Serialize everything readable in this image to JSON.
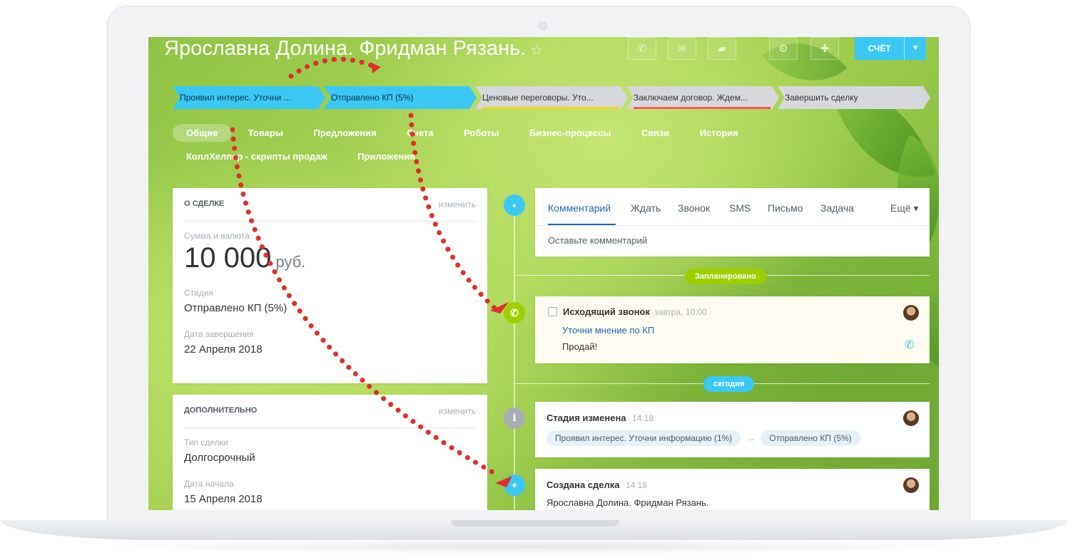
{
  "deal": {
    "title": "Ярославна Долина. Фридман Рязань.",
    "invoice_label": "СЧЁТ"
  },
  "stages": [
    {
      "label": "Проявил интерес. Уточни ...",
      "state": "done",
      "color": "#3bc8f5"
    },
    {
      "label": "Отправлено КП (5%)",
      "state": "done",
      "color": "#3bc8f5"
    },
    {
      "label": "Ценовые переговоры. Уто...",
      "state": "todo",
      "color": "#f7d622"
    },
    {
      "label": "Заключаем договор. Ждем...",
      "state": "todo",
      "color": "#ff5752"
    },
    {
      "label": "Завершить сделку",
      "state": "todo",
      "color": "#d6d8db"
    }
  ],
  "tabs": [
    "Общие",
    "Товары",
    "Предложения",
    "Счета",
    "Роботы",
    "Бизнес-процессы",
    "Связи",
    "История",
    "КоллХелпер - скрипты продаж",
    "Приложения"
  ],
  "about": {
    "title": "О СДЕЛКЕ",
    "edit": "изменить",
    "amount_label": "Сумма и валюта",
    "amount": "10 000",
    "currency": "руб.",
    "stage_label": "Стадия",
    "stage": "Отправлено КП (5%)",
    "close_label": "Дата завершения",
    "close_date": "22 Апреля 2018"
  },
  "extra": {
    "title": "ДОПОЛНИТЕЛЬНО",
    "edit": "изменить",
    "type_label": "Тип сделки",
    "type": "Долгосрочный",
    "start_label": "Дата начала",
    "start_date": "15 Апреля 2018"
  },
  "composer": {
    "tabs": [
      "Комментарий",
      "Ждать",
      "Звонок",
      "SMS",
      "Письмо",
      "Задача",
      "Ещё"
    ],
    "placeholder": "Оставьте комментарий"
  },
  "timeline": {
    "planned_badge": "Запланировано",
    "today_badge": "сегодня",
    "call": {
      "title": "Исходящий звонок",
      "time": "завтра, 10:00",
      "subject": "Уточни мнение по КП",
      "note": "Продай!"
    },
    "stage_change": {
      "title": "Стадия изменена",
      "time": "14:18",
      "from": "Проявил интерес. Уточни информацию (1%)",
      "to": "Отправлено КП (5%)"
    },
    "created": {
      "title": "Создана сделка",
      "time": "14:18",
      "text": "Ярославна Долина. Фридман Рязань."
    }
  },
  "colors": {
    "accent": "#3bc8f5",
    "link": "#2067b0",
    "planned": "#9dcf00",
    "annotation": "#e0302c"
  },
  "icons": {
    "phone": "phone-icon",
    "mail": "mail-icon",
    "chat": "chat-icon",
    "gear": "gear-icon",
    "star": "star-icon"
  }
}
